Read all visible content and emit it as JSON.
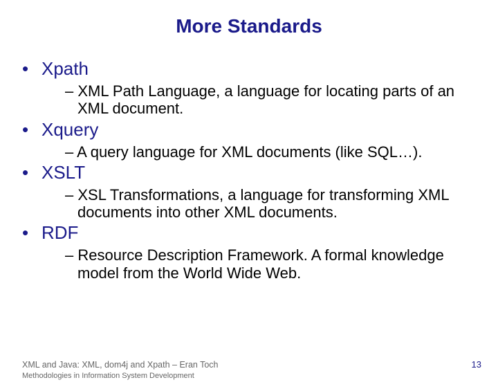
{
  "title": "More Standards",
  "items": [
    {
      "name": "Xpath",
      "desc": "XML Path Language, a language for locating parts of an XML document."
    },
    {
      "name": "Xquery",
      "desc": "A query language for XML documents (like SQL…)."
    },
    {
      "name": "XSLT",
      "desc": "XSL Transformations, a language for transforming XML documents into other XML documents."
    },
    {
      "name": "RDF",
      "desc": "Resource Description Framework. A formal knowledge model from the World Wide Web."
    }
  ],
  "footer": {
    "line1": "XML and Java: XML, dom4j and Xpath – Eran Toch",
    "line2": "Methodologies in Information System Development"
  },
  "page_num": "13"
}
